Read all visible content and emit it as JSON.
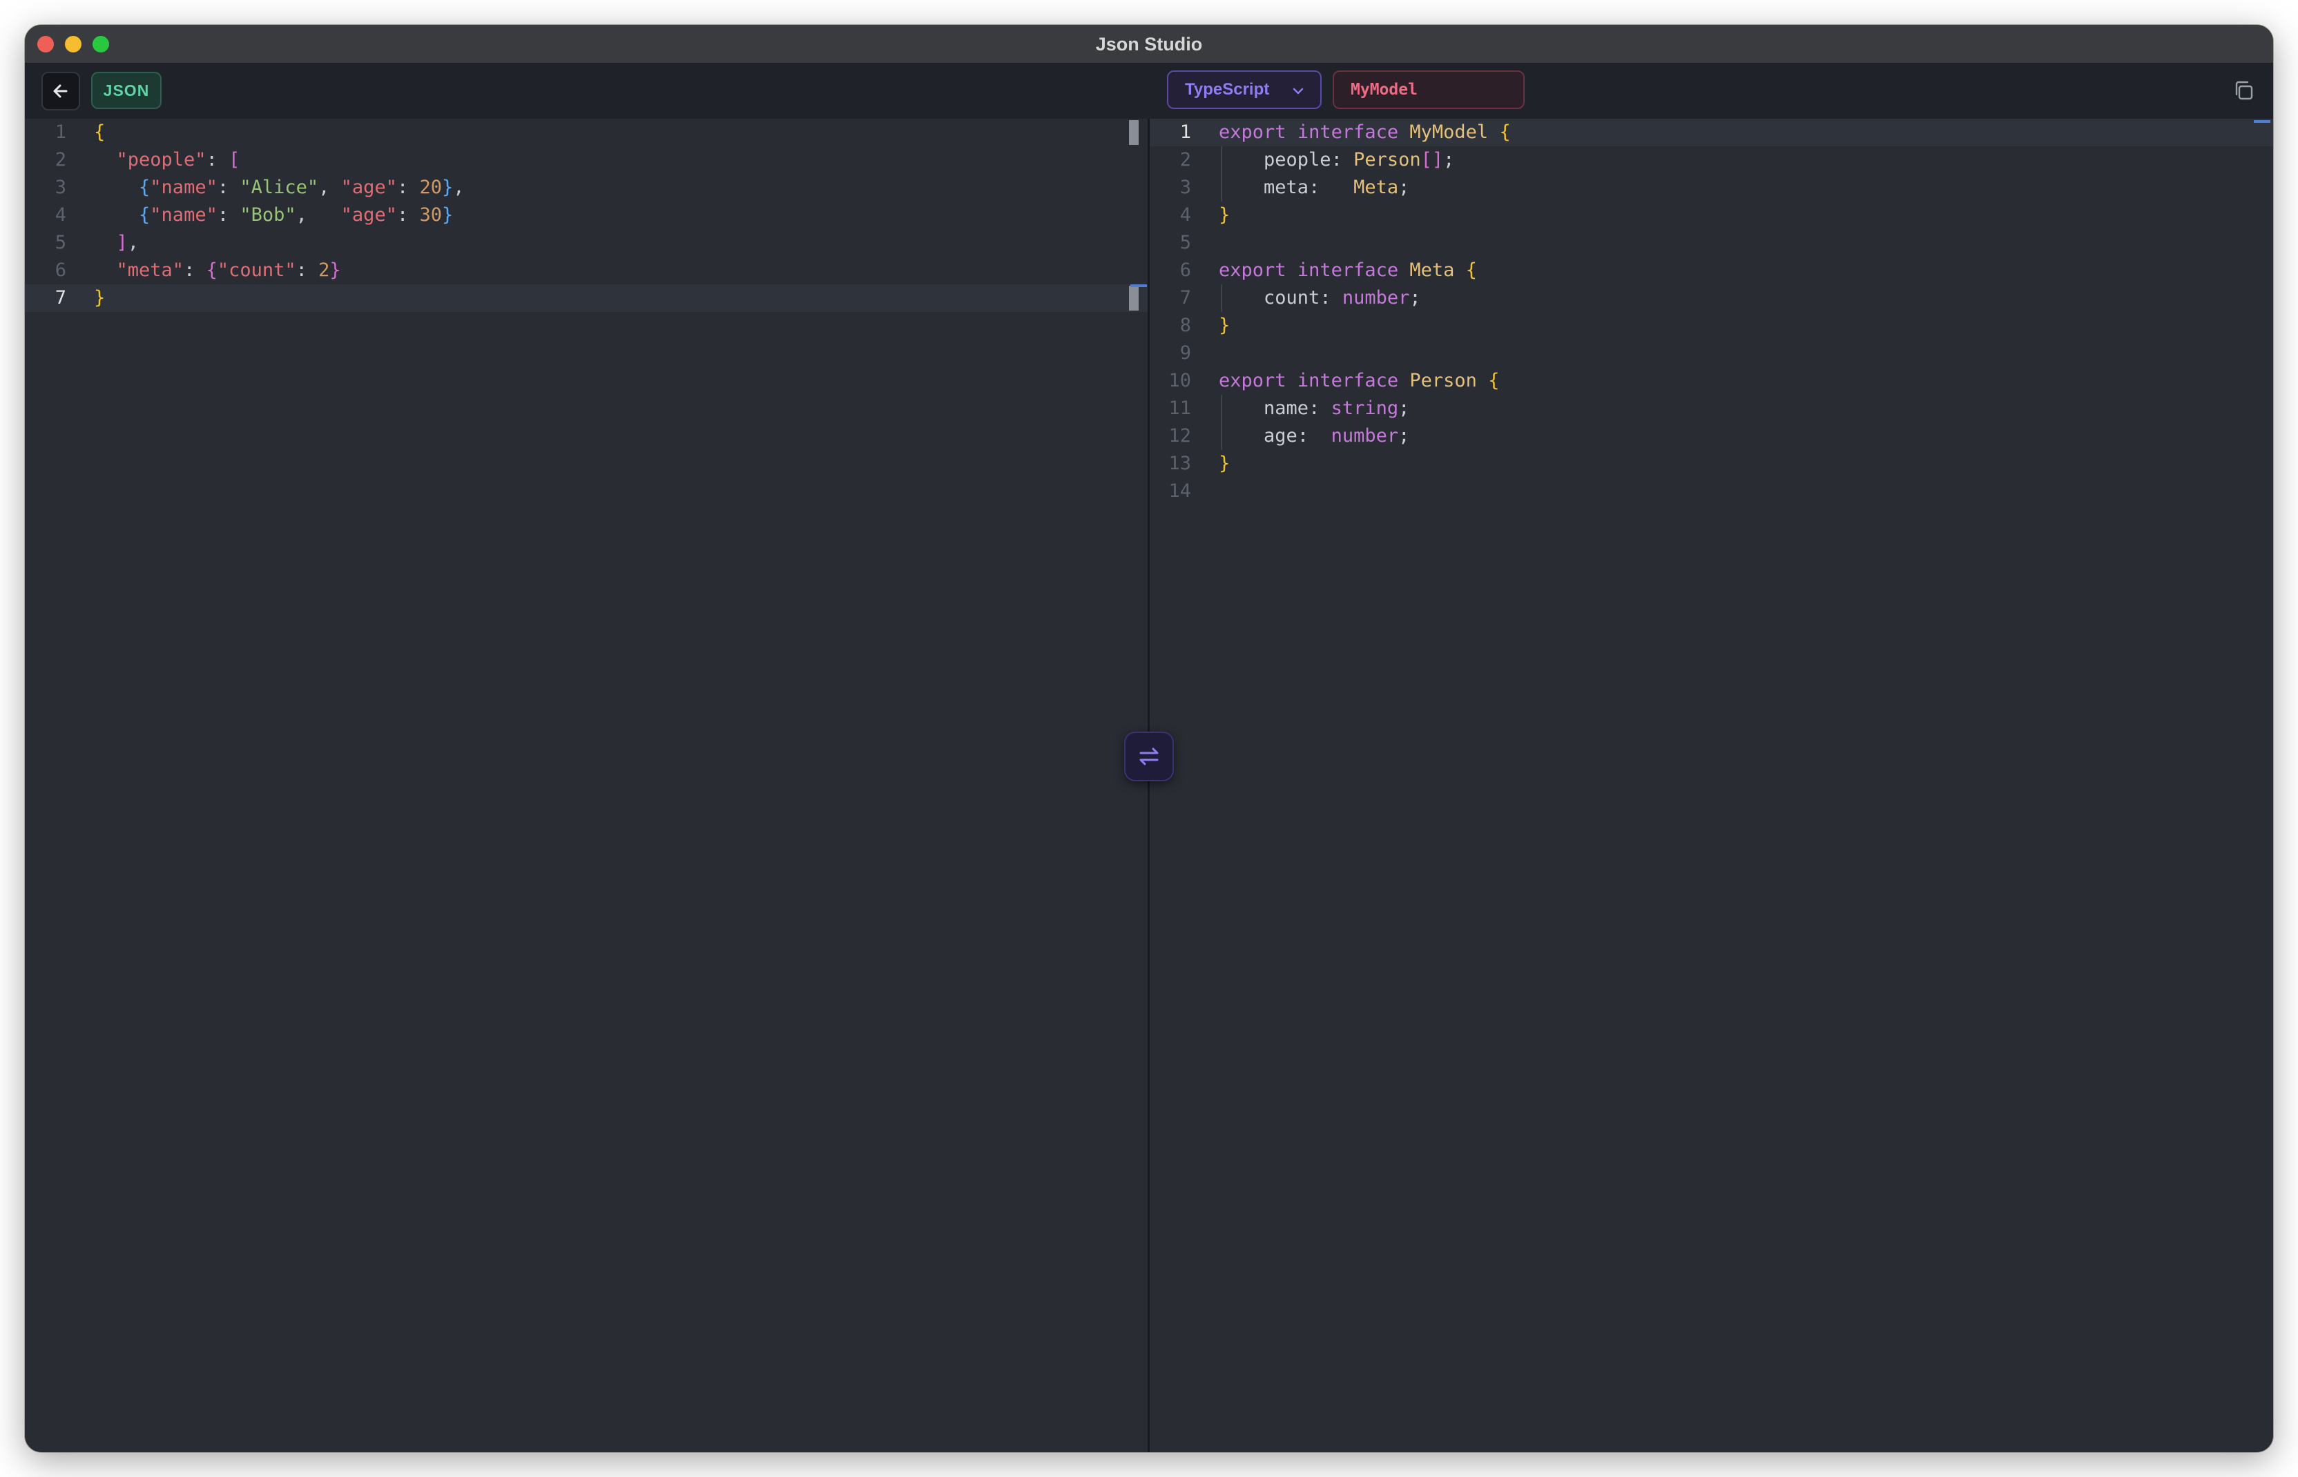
{
  "window": {
    "title": "Json Studio"
  },
  "toolbar": {
    "input_badge": "JSON",
    "language": "TypeScript",
    "model_name": "MyModel"
  },
  "colors": {
    "background": "#292c33",
    "toolbar": "#1f2228",
    "accent_purple": "#8f7cf0",
    "accent_green": "#5fd4a6",
    "accent_red": "#ef6b85"
  },
  "json_editor": {
    "active_line": 7,
    "lines": [
      {
        "n": "1",
        "tokens": [
          {
            "t": "{",
            "c": "br-y"
          }
        ]
      },
      {
        "n": "2",
        "tokens": [
          {
            "t": "  "
          },
          {
            "t": "\"people\"",
            "c": "s-key"
          },
          {
            "t": ": ",
            "c": "p"
          },
          {
            "t": "[",
            "c": "br-m"
          }
        ]
      },
      {
        "n": "3",
        "tokens": [
          {
            "t": "    "
          },
          {
            "t": "{",
            "c": "br-b"
          },
          {
            "t": "\"name\"",
            "c": "s-key"
          },
          {
            "t": ": ",
            "c": "p"
          },
          {
            "t": "\"Alice\"",
            "c": "s-val"
          },
          {
            "t": ", ",
            "c": "p"
          },
          {
            "t": "\"age\"",
            "c": "s-key"
          },
          {
            "t": ": ",
            "c": "p"
          },
          {
            "t": "20",
            "c": "num"
          },
          {
            "t": "}",
            "c": "br-b"
          },
          {
            "t": ",",
            "c": "p"
          }
        ]
      },
      {
        "n": "4",
        "tokens": [
          {
            "t": "    "
          },
          {
            "t": "{",
            "c": "br-b"
          },
          {
            "t": "\"name\"",
            "c": "s-key"
          },
          {
            "t": ": ",
            "c": "p"
          },
          {
            "t": "\"Bob\"",
            "c": "s-val"
          },
          {
            "t": ",   ",
            "c": "p"
          },
          {
            "t": "\"age\"",
            "c": "s-key"
          },
          {
            "t": ": ",
            "c": "p"
          },
          {
            "t": "30",
            "c": "num"
          },
          {
            "t": "}",
            "c": "br-b"
          }
        ]
      },
      {
        "n": "5",
        "tokens": [
          {
            "t": "  "
          },
          {
            "t": "]",
            "c": "br-m"
          },
          {
            "t": ",",
            "c": "p"
          }
        ]
      },
      {
        "n": "6",
        "tokens": [
          {
            "t": "  "
          },
          {
            "t": "\"meta\"",
            "c": "s-key"
          },
          {
            "t": ": ",
            "c": "p"
          },
          {
            "t": "{",
            "c": "br-m"
          },
          {
            "t": "\"count\"",
            "c": "s-key"
          },
          {
            "t": ": ",
            "c": "p"
          },
          {
            "t": "2",
            "c": "num"
          },
          {
            "t": "}",
            "c": "br-m"
          }
        ]
      },
      {
        "n": "7",
        "tokens": [
          {
            "t": "}",
            "c": "br-y"
          }
        ]
      }
    ]
  },
  "ts_editor": {
    "active_line": 1,
    "lines": [
      {
        "n": "1",
        "tokens": [
          {
            "t": "export",
            "c": "k"
          },
          {
            "t": " "
          },
          {
            "t": "interface",
            "c": "k"
          },
          {
            "t": " "
          },
          {
            "t": "MyModel",
            "c": "ty"
          },
          {
            "t": " "
          },
          {
            "t": "{",
            "c": "br-y"
          }
        ]
      },
      {
        "n": "2",
        "tokens": [
          {
            "t": "    "
          },
          {
            "t": "people",
            "c": "prop"
          },
          {
            "t": ": ",
            "c": "p"
          },
          {
            "t": "Person",
            "c": "ty"
          },
          {
            "t": "[]",
            "c": "br-m"
          },
          {
            "t": ";",
            "c": "p"
          }
        ]
      },
      {
        "n": "3",
        "tokens": [
          {
            "t": "    "
          },
          {
            "t": "meta",
            "c": "prop"
          },
          {
            "t": ":   ",
            "c": "p"
          },
          {
            "t": "Meta",
            "c": "ty"
          },
          {
            "t": ";",
            "c": "p"
          }
        ]
      },
      {
        "n": "4",
        "tokens": [
          {
            "t": "}",
            "c": "br-y"
          }
        ]
      },
      {
        "n": "5",
        "tokens": []
      },
      {
        "n": "6",
        "tokens": [
          {
            "t": "export",
            "c": "k"
          },
          {
            "t": " "
          },
          {
            "t": "interface",
            "c": "k"
          },
          {
            "t": " "
          },
          {
            "t": "Meta",
            "c": "ty"
          },
          {
            "t": " "
          },
          {
            "t": "{",
            "c": "br-y"
          }
        ]
      },
      {
        "n": "7",
        "tokens": [
          {
            "t": "    "
          },
          {
            "t": "count",
            "c": "prop"
          },
          {
            "t": ": ",
            "c": "p"
          },
          {
            "t": "number",
            "c": "prim"
          },
          {
            "t": ";",
            "c": "p"
          }
        ]
      },
      {
        "n": "8",
        "tokens": [
          {
            "t": "}",
            "c": "br-y"
          }
        ]
      },
      {
        "n": "9",
        "tokens": []
      },
      {
        "n": "10",
        "tokens": [
          {
            "t": "export",
            "c": "k"
          },
          {
            "t": " "
          },
          {
            "t": "interface",
            "c": "k"
          },
          {
            "t": " "
          },
          {
            "t": "Person",
            "c": "ty"
          },
          {
            "t": " "
          },
          {
            "t": "{",
            "c": "br-y"
          }
        ]
      },
      {
        "n": "11",
        "tokens": [
          {
            "t": "    "
          },
          {
            "t": "name",
            "c": "prop"
          },
          {
            "t": ": ",
            "c": "p"
          },
          {
            "t": "string",
            "c": "prim"
          },
          {
            "t": ";",
            "c": "p"
          }
        ]
      },
      {
        "n": "12",
        "tokens": [
          {
            "t": "    "
          },
          {
            "t": "age",
            "c": "prop"
          },
          {
            "t": ":  ",
            "c": "p"
          },
          {
            "t": "number",
            "c": "prim"
          },
          {
            "t": ";",
            "c": "p"
          }
        ]
      },
      {
        "n": "13",
        "tokens": [
          {
            "t": "}",
            "c": "br-y"
          }
        ]
      },
      {
        "n": "14",
        "tokens": []
      }
    ]
  },
  "icons": {
    "back": "arrow-left-icon",
    "dropdown": "chevron-down-icon",
    "copy": "copy-icon",
    "swap": "swap-arrows-icon"
  }
}
